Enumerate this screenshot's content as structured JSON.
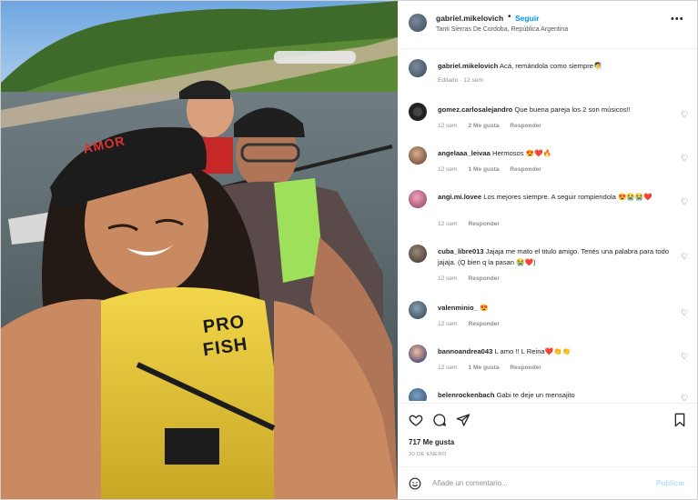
{
  "header": {
    "username": "gabriel.mikelovich",
    "separator": "•",
    "follow_label": "Seguir",
    "location": "Tanti Sierras De Cordoba, República Argentina",
    "more_label": "•••"
  },
  "photo": {
    "cap_text": "AMOR",
    "vest_text_line1": "PRO",
    "vest_text_line2": "FISH"
  },
  "caption": {
    "username": "gabriel.mikelovich",
    "text": "Acá, remándola como siempre🧖",
    "meta": "Editado · 12 sem"
  },
  "comments": [
    {
      "username": "gomez.carlosalejandro",
      "text": "Que buena pareja los 2 son músicos!!",
      "time": "12 sem",
      "likes": "2 Me gusta",
      "reply": "Responder"
    },
    {
      "username": "angelaaa_leivaa",
      "text": "Hermosos 😍❤️🔥",
      "time": "12 sem",
      "likes": "1 Me gusta",
      "reply": "Responder"
    },
    {
      "username": "angi.mi.lovee",
      "text": "Los mejores siempre. A seguir rompiendola 😍😭😭❤️",
      "time": "12 sem",
      "likes": "",
      "reply": "Responder"
    },
    {
      "username": "cuba_libre013",
      "text": "Jajaja me mato el titulo amigo. Tenés una palabra para todo jajaja. (Q bien q la pasan 😭❤️)",
      "time": "12 sem",
      "likes": "",
      "reply": "Responder"
    },
    {
      "username": "valenminio_",
      "text": "😍",
      "time": "12 sem",
      "likes": "",
      "reply": "Responder"
    },
    {
      "username": "bannoandrea043",
      "text": "L amo !! L Reina❤️👏👏",
      "time": "12 sem",
      "likes": "1 Me gusta",
      "reply": "Responder"
    },
    {
      "username": "belenrockenbach",
      "text": "Gabi te deje un mensajito",
      "time": "",
      "likes": "",
      "reply": ""
    }
  ],
  "actions": {
    "likes_count": "717 Me gusta",
    "date": "30 DE ENERO"
  },
  "composer": {
    "placeholder": "Añade un comentario...",
    "publish_label": "Publicar"
  },
  "colors": {
    "accent": "#0095f6",
    "publish_disabled": "#b2dffc",
    "text": "#262626",
    "muted": "#8e8e8e"
  }
}
